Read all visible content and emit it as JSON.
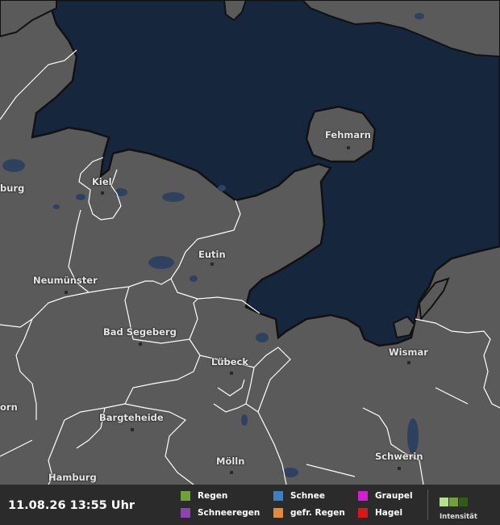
{
  "map": {
    "cities": [
      {
        "id": "fehmarn",
        "name": "Fehmarn"
      },
      {
        "id": "kiel",
        "name": "Kiel"
      },
      {
        "id": "eutin",
        "name": "Eutin"
      },
      {
        "id": "neumuenster",
        "name": "Neumünster"
      },
      {
        "id": "bad-segeberg",
        "name": "Bad Segeberg"
      },
      {
        "id": "luebeck",
        "name": "Lübeck"
      },
      {
        "id": "wismar",
        "name": "Wismar"
      },
      {
        "id": "bargteheide",
        "name": "Bargteheide"
      },
      {
        "id": "moelln",
        "name": "Mölln"
      },
      {
        "id": "schwerin",
        "name": "Schwerin"
      },
      {
        "id": "hamburg",
        "name": "Hamburg"
      },
      {
        "id": "rendsburg-partial",
        "name": "burg"
      },
      {
        "id": "elmshorn-partial",
        "name": "orn"
      }
    ],
    "colors": {
      "land": "#5a5a5a",
      "sea": "#16263d",
      "border": "#ffffff",
      "coast": "#111111",
      "lake": "#2e4260"
    }
  },
  "legend": {
    "timestamp": "11.08.26 13:55 Uhr",
    "items": [
      {
        "id": "regen",
        "label": "Regen",
        "color": "#6fa33a"
      },
      {
        "id": "schnee",
        "label": "Schnee",
        "color": "#3f7fbf"
      },
      {
        "id": "graupel",
        "label": "Graupel",
        "color": "#d41ed4"
      },
      {
        "id": "schneeregen",
        "label": "Schneeregen",
        "color": "#8e44ad"
      },
      {
        "id": "gefr-regen",
        "label": "gefr. Regen",
        "color": "#e08a3c"
      },
      {
        "id": "hagel",
        "label": "Hagel",
        "color": "#d81818"
      }
    ],
    "intensity_label": "Intensität",
    "intensity_colors": [
      "#b6e08a",
      "#6fa33a",
      "#2f5e12"
    ]
  }
}
